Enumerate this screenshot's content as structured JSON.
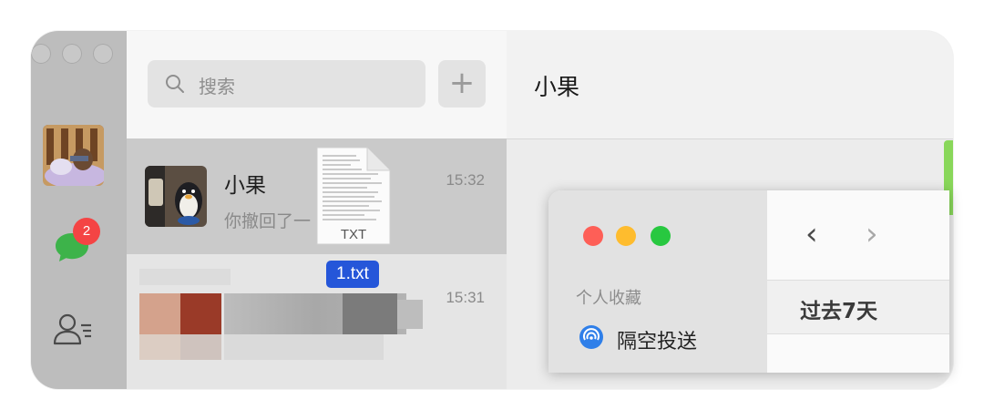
{
  "search": {
    "placeholder": "搜索"
  },
  "new_chat_button": "+",
  "unread_badge": "2",
  "chats": [
    {
      "name": "小果",
      "time": "15:32",
      "preview": "你撤回了一"
    },
    {
      "name": "",
      "time": "15:31",
      "preview": ""
    }
  ],
  "conversation": {
    "title": "小果"
  },
  "drag_file": {
    "icon_label": "TXT",
    "filename": "1.txt"
  },
  "finder": {
    "favorites_header": "个人收藏",
    "airdrop_label": "隔空投送",
    "section": "过去7天",
    "back": "‹",
    "forward": "›"
  },
  "colors": {
    "badge": "#f44444",
    "active_row": "#cacaca",
    "close": "#fe5f57",
    "minimize": "#febc2e",
    "zoom": "#28c840",
    "file_tag": "#2556d9",
    "chat_bubble_edge": "#89d75a"
  }
}
